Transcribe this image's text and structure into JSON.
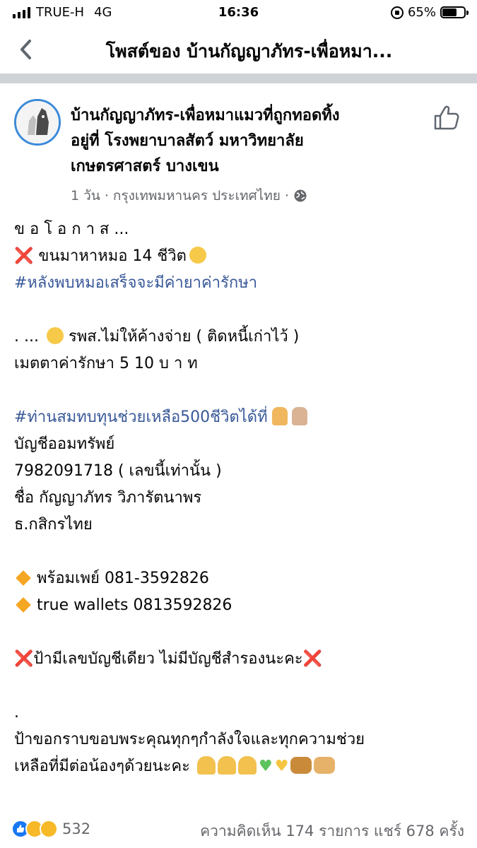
{
  "status_bar": {
    "carrier": "TRUE-H",
    "network": "4G",
    "time": "16:36",
    "battery": "65%",
    "battery_level": 0.65
  },
  "nav": {
    "title": "โพสต์ของ บ้านกัญญาภัทร-เพื่อหมา..."
  },
  "post": {
    "author_lines": [
      "บ้านกัญญาภัทร-เพื่อหมาแมวที่ถูกทอดทิ้ง",
      "อยู่ที่ โรงพยาบาลสัตว์ มหาวิทยาลัย",
      "เกษตรศาสตร์ บางเขน"
    ],
    "meta": "1 วัน · กรุงเทพมหานคร ประเทศไทย ·",
    "body": {
      "l1": "ข อ โ อ ก า ส ...",
      "l2_mark": "❌",
      "l2_text": " ขนมาหาหมอ 14 ชีวิต",
      "l3": "#หลังพบหมอเสร็จจะมีค่ายาค่ารักษา",
      "l4_a": ". ...",
      "l4_b": " รพส.ไม่ให้ค้างจ่าย ( ติดหนี้เก่าไว้ )",
      "l5": "เมตตาค่ารักษา 5 10 บ า ท",
      "l6": "#ท่านสมทบทุนช่วยเหลือ500ชีวิตได้ที่",
      "l7": "บัญชีออมทรัพย์",
      "l8": "7982091718 ( เลขนี้เท่านั้น )",
      "l9": "ชื่อ กัญญาภัทร วิภารัตนาพร",
      "l10": "ธ.กสิกรไทย",
      "l11": "พร้อมเพย์ 081-3592826",
      "l12": "true wallets 0813592826",
      "l13_mark": "❌",
      "l13_text": "ป้ามีเลขบัญชีเดียว ไม่มีบัญชีสำรองนะคะ",
      "l14": ".",
      "l15": "ป้าขอกราบขอบพระคุณทุกๆกำลังใจและทุกความช่วย",
      "l16": "เหลือที่มีต่อน้องๆด้วยนะคะ"
    }
  },
  "footer": {
    "reaction_count": "532",
    "comments_shares": "ความคิดเห็น 174 รายการ  แชร์ 678 ครั้ง"
  },
  "icons": {
    "back": "chevron-left-icon",
    "like": "thumbs-up-icon",
    "globe": "globe-icon"
  },
  "colors": {
    "hashtag": "#385898",
    "avatar_ring": "#3b8ad9",
    "divider": "#cfd2d6"
  }
}
